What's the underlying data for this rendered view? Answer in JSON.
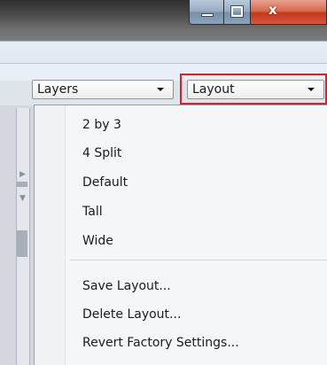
{
  "window": {
    "caption_buttons": {
      "minimize_icon": "minimize-icon",
      "maximize_icon": "maximize-icon",
      "close_glyph": "x"
    },
    "close_color": "#c4391d"
  },
  "toolbar": {
    "layers_combo": {
      "value": "Layers"
    },
    "layout_combo": {
      "value": "Layout"
    },
    "highlight_color": "#d9202a"
  },
  "layout_menu": {
    "items": [
      {
        "label": "2 by 3"
      },
      {
        "label": "4 Split"
      },
      {
        "label": "Default"
      },
      {
        "label": "Tall"
      },
      {
        "label": "Wide"
      }
    ],
    "actions": [
      {
        "label": "Save Layout..."
      },
      {
        "label": "Delete Layout..."
      },
      {
        "label": "Revert Factory Settings..."
      }
    ]
  }
}
